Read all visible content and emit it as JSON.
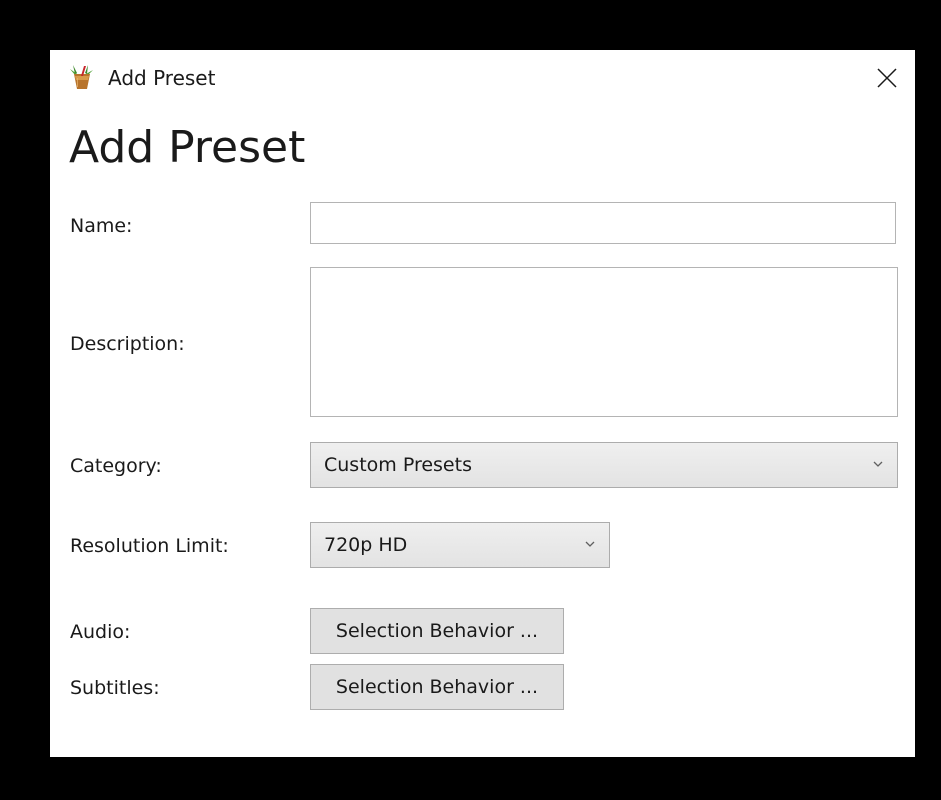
{
  "window": {
    "title": "Add Preset",
    "icon": "handbrake-app-icon",
    "close_icon": "close-icon"
  },
  "heading": "Add Preset",
  "form": {
    "name": {
      "label": "Name:",
      "value": ""
    },
    "description": {
      "label": "Description:",
      "value": ""
    },
    "category": {
      "label": "Category:",
      "selected": "Custom Presets"
    },
    "resolution_limit": {
      "label": "Resolution Limit:",
      "selected": "720p HD"
    },
    "audio": {
      "label": "Audio:",
      "button_label": "Selection Behavior ..."
    },
    "subtitles": {
      "label": "Subtitles:",
      "button_label": "Selection Behavior ..."
    }
  },
  "colors": {
    "backdrop": "#000000",
    "dialog_background": "#ffffff",
    "button_face": "#e1e1e1",
    "control_border": "#adadad"
  }
}
